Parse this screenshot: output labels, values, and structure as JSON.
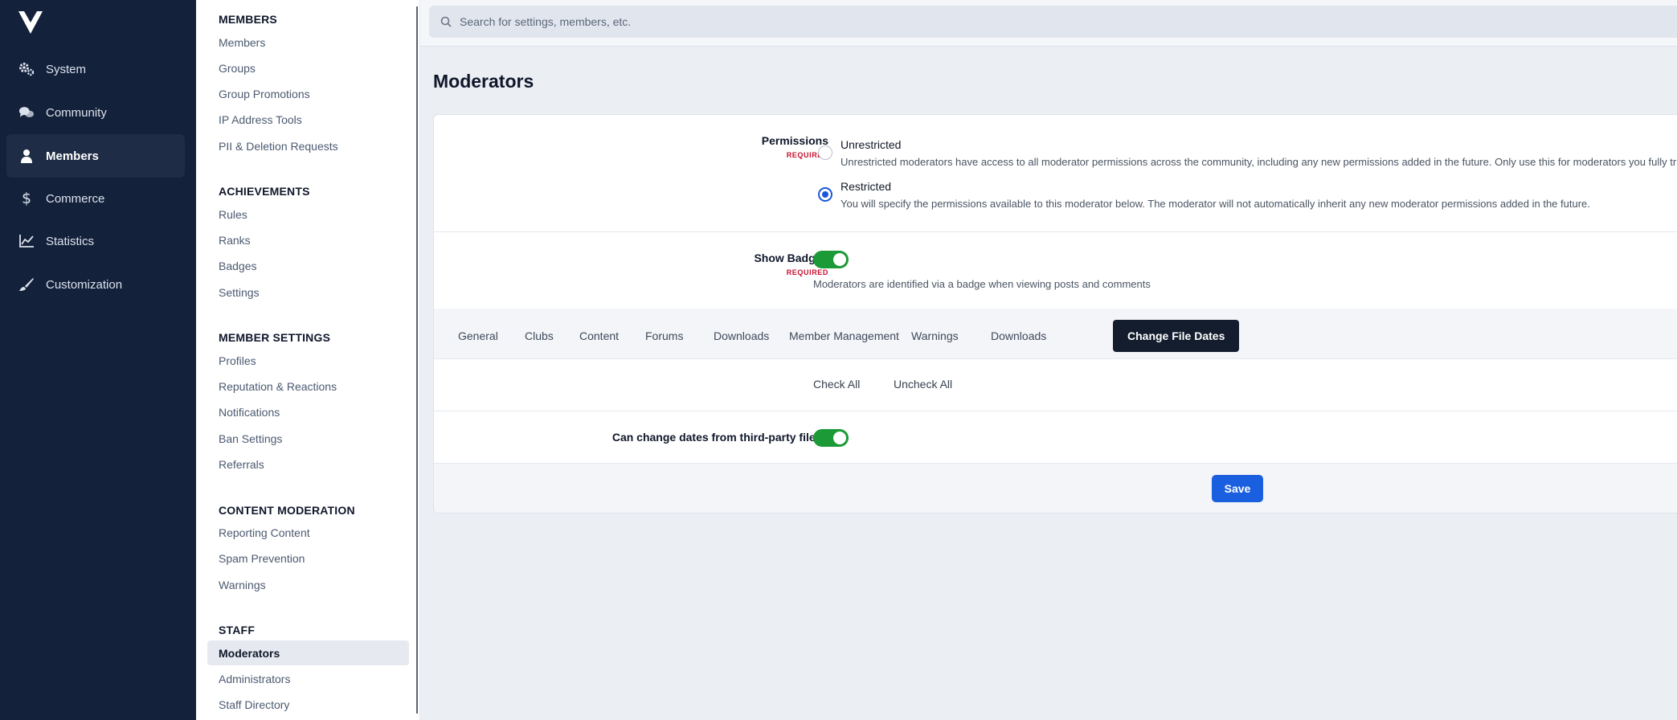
{
  "nav": {
    "items": [
      {
        "label": "System",
        "icon": "gears-icon"
      },
      {
        "label": "Community",
        "icon": "chat-bubbles-icon"
      },
      {
        "label": "Members",
        "icon": "person-icon"
      },
      {
        "label": "Commerce",
        "icon": "dollar-icon"
      },
      {
        "label": "Statistics",
        "icon": "line-chart-icon"
      },
      {
        "label": "Customization",
        "icon": "brush-icon"
      }
    ],
    "active": "Members"
  },
  "subnav": {
    "sections": [
      {
        "heading": "MEMBERS",
        "items": [
          "Members",
          "Groups",
          "Group Promotions",
          "IP Address Tools",
          "PII & Deletion Requests"
        ]
      },
      {
        "heading": "ACHIEVEMENTS",
        "items": [
          "Rules",
          "Ranks",
          "Badges",
          "Settings"
        ]
      },
      {
        "heading": "MEMBER SETTINGS",
        "items": [
          "Profiles",
          "Reputation & Reactions",
          "Notifications",
          "Ban Settings",
          "Referrals"
        ]
      },
      {
        "heading": "CONTENT MODERATION",
        "items": [
          "Reporting Content",
          "Spam Prevention",
          "Warnings"
        ]
      },
      {
        "heading": "STAFF",
        "items": [
          "Moderators",
          "Administrators",
          "Staff Directory"
        ]
      }
    ],
    "active": "Moderators"
  },
  "search": {
    "placeholder": "Search for settings, members, etc."
  },
  "page": {
    "title": "Moderators"
  },
  "form": {
    "permissions": {
      "label": "Permissions",
      "required": "REQUIRED",
      "options": [
        {
          "title": "Unrestricted",
          "desc": "Unrestricted moderators have access to all moderator permissions across the community, including any new permissions added in the future. Only use this for moderators you fully trust.",
          "selected": false
        },
        {
          "title": "Restricted",
          "desc": "You will specify the permissions available to this moderator below. The moderator will not automatically inherit any new moderator permissions added in the future.",
          "selected": true
        }
      ]
    },
    "show_badge": {
      "label": "Show Badge?",
      "required": "REQUIRED",
      "on": true,
      "help": "Moderators are identified via a badge when viewing posts and comments"
    },
    "tabs": [
      "General",
      "Clubs",
      "Content",
      "Forums",
      "Downloads",
      "Member Management",
      "Warnings",
      "Downloads",
      "Change File Dates"
    ],
    "active_tab": "Change File Dates",
    "check_all": "Check All",
    "uncheck_all": "Uncheck All",
    "change_dates": {
      "label": "Can change dates from third-party files?",
      "on": true
    },
    "save": "Save"
  },
  "colors": {
    "nav_bg": "#14213a",
    "accent": "#1a5fe0",
    "toggle_on": "#1c9a37",
    "required": "#c8102e"
  }
}
